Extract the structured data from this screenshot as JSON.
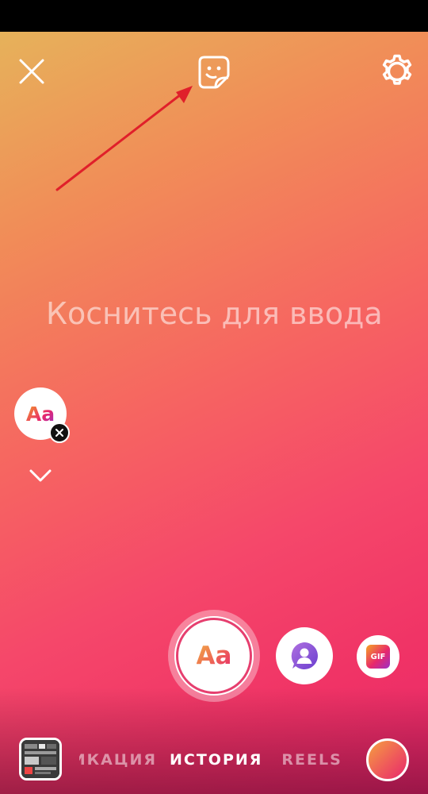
{
  "editor": {
    "placeholder": "Коснитесь для ввода",
    "font_chip_label": "Aa",
    "main_button_label": "Aa"
  },
  "toolbar": {
    "close_icon": "close-icon",
    "sticker_icon": "sticker-icon",
    "settings_icon": "settings-icon"
  },
  "actions": {
    "gif_label": "GIF",
    "mention_icon": "mention-icon"
  },
  "modes": {
    "previous": "ПУБЛИКАЦИЯ",
    "active": "ИСТОРИЯ",
    "next": "REELS"
  },
  "annotation": {
    "arrow_color": "#e0202a",
    "target": "sticker-icon"
  },
  "colors": {
    "gradient_start": "#e6b25a",
    "gradient_end": "#e8276a",
    "accent": "#e63f6f"
  }
}
